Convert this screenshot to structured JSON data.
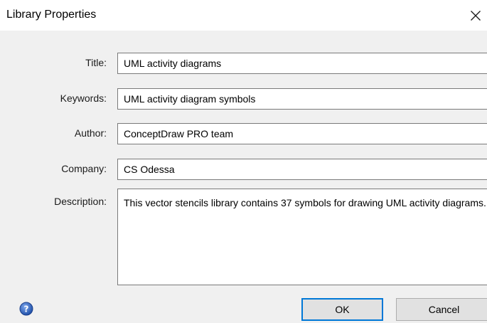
{
  "window": {
    "title": "Library Properties"
  },
  "icons": {
    "close": "close-icon",
    "help": "help-icon"
  },
  "colors": {
    "accent": "#0078d7",
    "help_icon": "#2f5fb8"
  },
  "form": {
    "title_label": "Title:",
    "title_value": "UML activity diagrams",
    "keywords_label": "Keywords:",
    "keywords_value": "UML activity diagram symbols",
    "author_label": "Author:",
    "author_value": "ConceptDraw PRO team",
    "company_label": "Company:",
    "company_value": "CS Odessa",
    "description_label": "Description:",
    "description_value": "This vector stencils library contains 37 symbols for drawing UML activity diagrams."
  },
  "buttons": {
    "ok_label": "OK",
    "cancel_label": "Cancel"
  }
}
